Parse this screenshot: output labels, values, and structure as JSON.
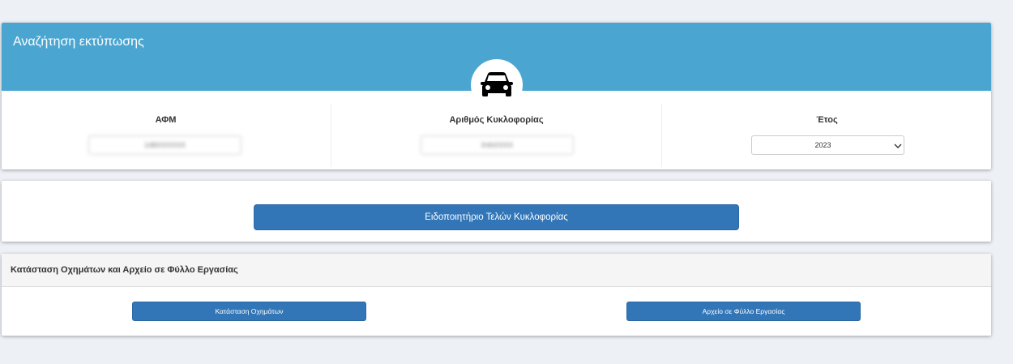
{
  "search": {
    "title": "Αναζήτηση εκτύπωσης",
    "icon": "car-icon",
    "fields": {
      "afm": {
        "label": "ΑΦΜ",
        "value": "148XXXXXX"
      },
      "plate": {
        "label": "Αριθμός Κυκλοφορίας",
        "value": "ΙΗΑXXXX"
      },
      "year": {
        "label": "Έτος",
        "value": "2023"
      }
    }
  },
  "notice": {
    "button_label": "Ειδοποιητήριο Τελών Κυκλοφορίας"
  },
  "status": {
    "title": "Κατάσταση Οχημάτων και Αρχείο σε Φύλλο Εργασίας",
    "vehicles_button": "Κατάσταση Οχημάτων",
    "spreadsheet_button": "Αρχείο σε Φύλλο Εργασίας"
  },
  "colors": {
    "header": "#4aa6d1",
    "button": "#3276b8",
    "background": "#edf0f5"
  }
}
